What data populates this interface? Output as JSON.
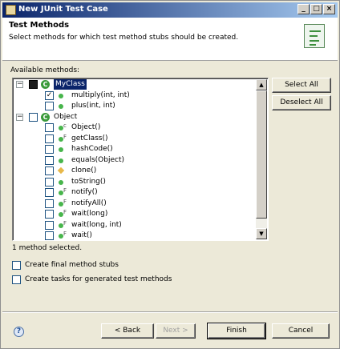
{
  "window": {
    "title": "New JUnit Test Case",
    "controls": {
      "minimize": "_",
      "maximize": "□",
      "close": "×"
    }
  },
  "header": {
    "title": "Test Methods",
    "description": "Select methods for which test method stubs should be created."
  },
  "available_label": "Available methods:",
  "tree": {
    "rows": [
      {
        "label": "MyClass",
        "kind": "class",
        "checked": "dark",
        "expander": "−",
        "selected": true,
        "badge": ""
      },
      {
        "label": "multiply(int, int)",
        "kind": "method",
        "checked": "check",
        "badge": ""
      },
      {
        "label": "plus(int, int)",
        "kind": "method",
        "checked": "",
        "badge": ""
      },
      {
        "label": "Object",
        "kind": "class",
        "checked": "",
        "expander": "−",
        "selected": false,
        "badge": ""
      },
      {
        "label": "Object()",
        "kind": "method",
        "checked": "",
        "badge": "c"
      },
      {
        "label": "getClass()",
        "kind": "method",
        "checked": "",
        "badge": "F"
      },
      {
        "label": "hashCode()",
        "kind": "method",
        "checked": "",
        "badge": ""
      },
      {
        "label": "equals(Object)",
        "kind": "method",
        "checked": "",
        "badge": ""
      },
      {
        "label": "clone()",
        "kind": "protected",
        "checked": "",
        "badge": ""
      },
      {
        "label": "toString()",
        "kind": "method",
        "checked": "",
        "badge": ""
      },
      {
        "label": "notify()",
        "kind": "method",
        "checked": "",
        "badge": "F"
      },
      {
        "label": "notifyAll()",
        "kind": "method",
        "checked": "",
        "badge": "F"
      },
      {
        "label": "wait(long)",
        "kind": "method",
        "checked": "",
        "badge": "F"
      },
      {
        "label": "wait(long, int)",
        "kind": "method",
        "checked": "",
        "badge": "F"
      },
      {
        "label": "wait()",
        "kind": "method",
        "checked": "",
        "badge": "F"
      }
    ]
  },
  "buttons": {
    "select_all": "Select All",
    "deselect_all": "Deselect All",
    "back": "< Back",
    "next": "Next >",
    "finish": "Finish",
    "cancel": "Cancel"
  },
  "status": "1 method selected.",
  "options": {
    "final_stubs": "Create final method stubs",
    "tasks": "Create tasks for generated test methods"
  },
  "help_icon": "?",
  "colors": {
    "title_bar": "#0a246a",
    "selection": "#0a246a",
    "method_icon": "#47b54b",
    "dialog_bg": "#ece9d8"
  }
}
